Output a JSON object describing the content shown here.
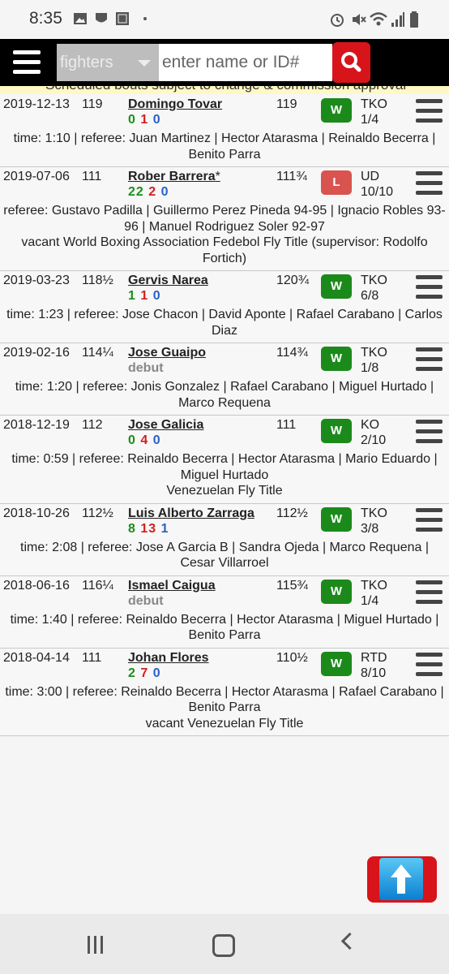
{
  "status_bar": {
    "time": "8:35"
  },
  "header": {
    "search_category": "fighters",
    "search_placeholder": "enter name or ID#",
    "notice": "Scheduled bouts subject to change & commission approval"
  },
  "fights": [
    {
      "date": "2019-12-13",
      "weight": "119",
      "opponent": "Domingo Tovar",
      "record": [
        "0",
        "1",
        "0"
      ],
      "opp_weight": "119",
      "result": "W",
      "type": "TKO",
      "round": "1/4",
      "details": [
        "time: 1:10 | referee: Juan Martinez | Hector Atarasma | Reinaldo Becerra | Benito Parra"
      ]
    },
    {
      "date": "2019-07-06",
      "weight": "111",
      "opponent": "Rober Barrera",
      "opp_suffix": "*",
      "record": [
        "22",
        "2",
        "0"
      ],
      "opp_weight": "111¾",
      "result": "L",
      "type": "UD",
      "round": "10/10",
      "details": [
        "referee: Gustavo Padilla | Guillermo Perez Pineda 94-95 | Ignacio Robles 93-96 | Manuel Rodriguez Soler 92-97",
        "vacant World Boxing Association Fedebol Fly Title (supervisor: Rodolfo Fortich)"
      ]
    },
    {
      "date": "2019-03-23",
      "weight": "118½",
      "opponent": "Gervis Narea",
      "record": [
        "1",
        "1",
        "0"
      ],
      "opp_weight": "120¾",
      "result": "W",
      "type": "TKO",
      "round": "6/8",
      "details": [
        "time: 1:23 | referee: Jose Chacon | David Aponte | Rafael Carabano | Carlos Diaz"
      ]
    },
    {
      "date": "2019-02-16",
      "weight": "114¼",
      "opponent": "Jose Guaipo",
      "debut": "debut",
      "opp_weight": "114¾",
      "result": "W",
      "type": "TKO",
      "round": "1/8",
      "details": [
        "time: 1:20 | referee: Jonis Gonzalez | Rafael Carabano | Miguel Hurtado | Marco Requena"
      ]
    },
    {
      "date": "2018-12-19",
      "weight": "112",
      "opponent": "Jose Galicia",
      "record": [
        "0",
        "4",
        "0"
      ],
      "opp_weight": "111",
      "result": "W",
      "type": "KO",
      "round": "2/10",
      "details": [
        "time: 0:59 | referee: Reinaldo Becerra | Hector Atarasma | Mario Eduardo | Miguel Hurtado",
        "Venezuelan Fly Title"
      ]
    },
    {
      "date": "2018-10-26",
      "weight": "112½",
      "opponent": "Luis Alberto Zarraga",
      "record": [
        "8",
        "13",
        "1"
      ],
      "opp_weight": "112½",
      "result": "W",
      "type": "TKO",
      "round": "3/8",
      "details": [
        "time: 2:08 | referee: Jose A Garcia B | Sandra Ojeda | Marco Requena | Cesar Villarroel"
      ]
    },
    {
      "date": "2018-06-16",
      "weight": "116¼",
      "opponent": "Ismael Caigua",
      "debut": "debut",
      "opp_weight": "115¾",
      "result": "W",
      "type": "TKO",
      "round": "1/4",
      "details": [
        "time: 1:40 | referee: Reinaldo Becerra | Hector Atarasma | Miguel Hurtado | Benito Parra"
      ]
    },
    {
      "date": "2018-04-14",
      "weight": "111",
      "opponent": "Johan Flores",
      "record": [
        "2",
        "7",
        "0"
      ],
      "opp_weight": "110½",
      "result": "W",
      "type": "RTD",
      "round": "8/10",
      "details": [
        "time: 3:00 | referee: Reinaldo Becerra | Hector Atarasma | Rafael Carabano | Benito Parra",
        "vacant Venezuelan Fly Title"
      ]
    }
  ],
  "colors": {
    "win": "#1b8a1b",
    "loss": "#d9534f",
    "header_bg": "#000000",
    "search_button": "#d8141b"
  },
  "icons": {
    "search": "search-icon",
    "menu": "hamburger-icon",
    "scroll_top": "arrow-up-icon"
  }
}
